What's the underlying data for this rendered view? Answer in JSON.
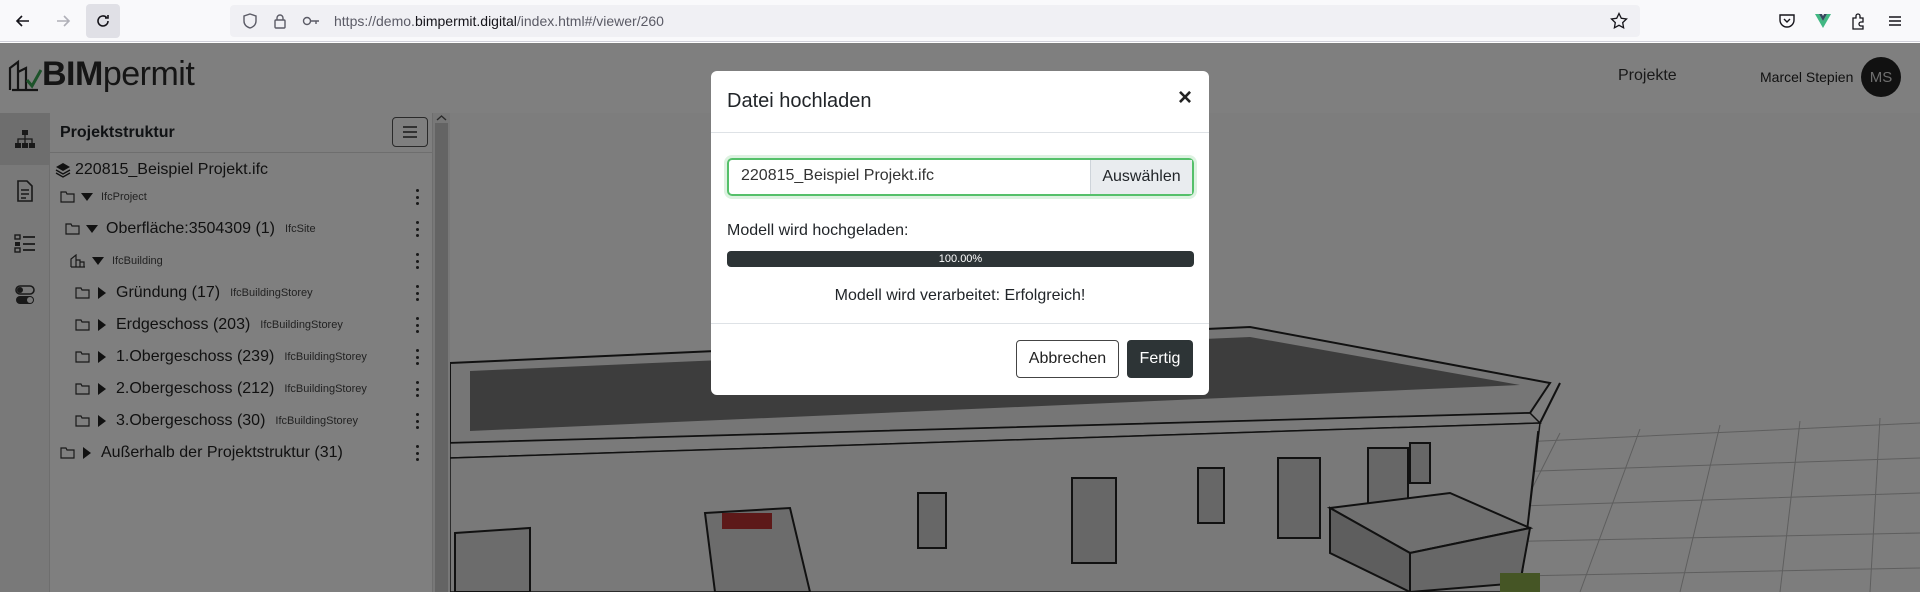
{
  "browser": {
    "url_prefix": "https://demo.",
    "url_host": "bimpermit.digital",
    "url_path": "/index.html#/viewer/260"
  },
  "header": {
    "logo_bold": "BIM",
    "logo_light": "permit",
    "nav_projects": "Projekte",
    "user_name": "Marcel Stepien",
    "avatar_initials": "MS"
  },
  "sidebar": {
    "title": "Projektstruktur",
    "file_name": "220815_Beispiel Projekt.ifc",
    "rows": [
      {
        "label": "",
        "type": "IfcProject"
      },
      {
        "label": "Oberfläche:3504309 (1)",
        "type": "IfcSite"
      },
      {
        "label": "",
        "type": "IfcBuilding"
      },
      {
        "label": "Gründung (17)",
        "type": "IfcBuildingStorey"
      },
      {
        "label": "Erdgeschoss (203)",
        "type": "IfcBuildingStorey"
      },
      {
        "label": "1.Obergeschoss (239)",
        "type": "IfcBuildingStorey"
      },
      {
        "label": "2.Obergeschoss (212)",
        "type": "IfcBuildingStorey"
      },
      {
        "label": "3.Obergeschoss (30)",
        "type": "IfcBuildingStorey"
      },
      {
        "label": "Außerhalb der Projektstruktur (31)",
        "type": ""
      }
    ]
  },
  "modal": {
    "title": "Datei hochladen",
    "close_symbol": "×",
    "file_value": "220815_Beispiel Projekt.ifc",
    "file_button": "Auswählen",
    "upload_label": "Modell wird hochgeladen:",
    "progress_percent": 100,
    "progress_text": "100.00%",
    "process_text": "Modell wird verarbeitet: Erfolgreich!",
    "cancel_label": "Abbrechen",
    "done_label": "Fertig"
  },
  "colors": {
    "dark": "#2d3436",
    "success_border": "#55c06a"
  }
}
